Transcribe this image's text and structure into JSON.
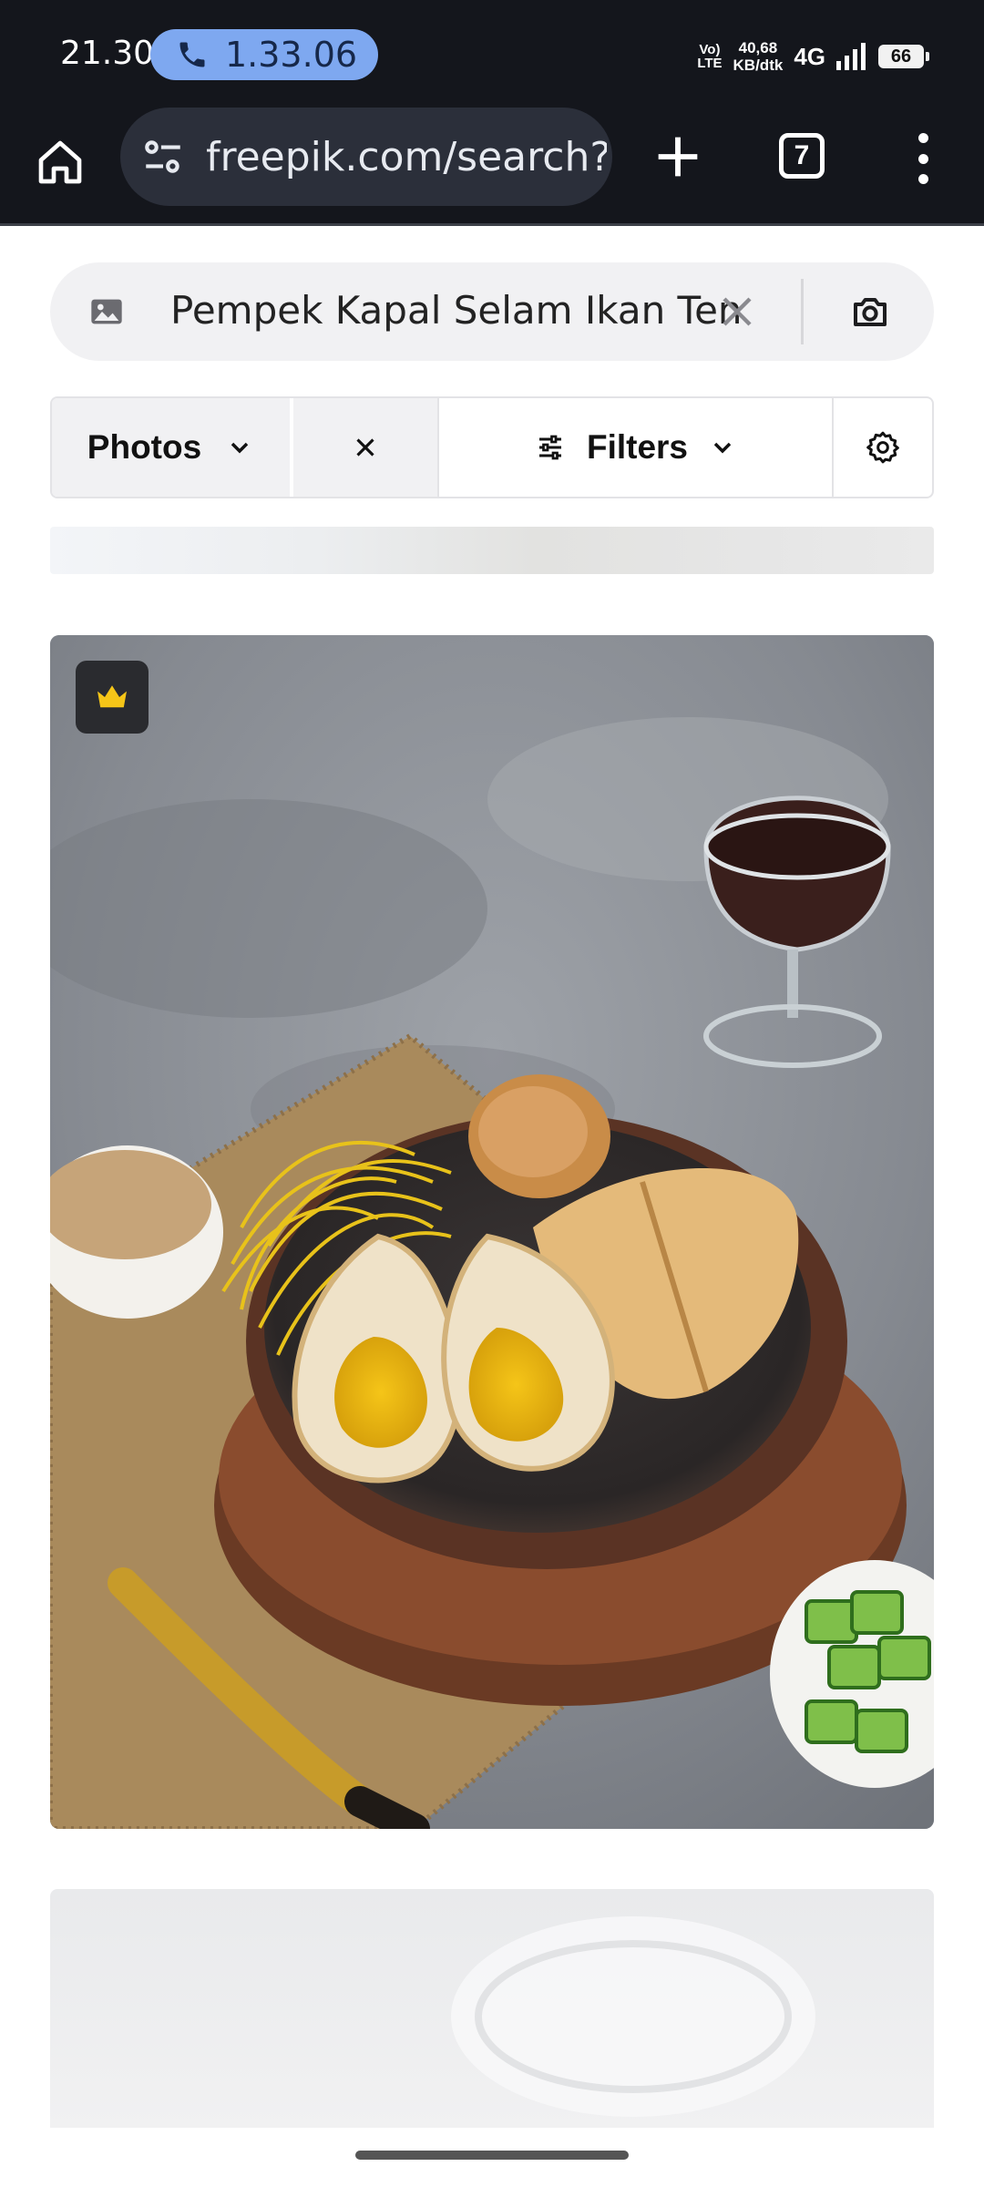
{
  "status_bar": {
    "time": "21.30",
    "call_duration": "1.33.06",
    "volte_top": "Vo)",
    "volte_bottom": "LTE",
    "speed_value": "40,68",
    "speed_unit": "KB/dtk",
    "network": "4G",
    "battery": "66"
  },
  "browser": {
    "url": "freepik.com/search?fo",
    "tab_count": "7"
  },
  "search": {
    "query": "Pempek Kapal Selam Ikan Tenggiri"
  },
  "filters": {
    "type_label": "Photos",
    "filters_label": "Filters"
  },
  "results": {
    "premium_icon": "crown-icon"
  },
  "colors": {
    "status_bg": "#14161c",
    "call_pill": "#7ea8f0",
    "premium_crown": "#f5c518"
  }
}
